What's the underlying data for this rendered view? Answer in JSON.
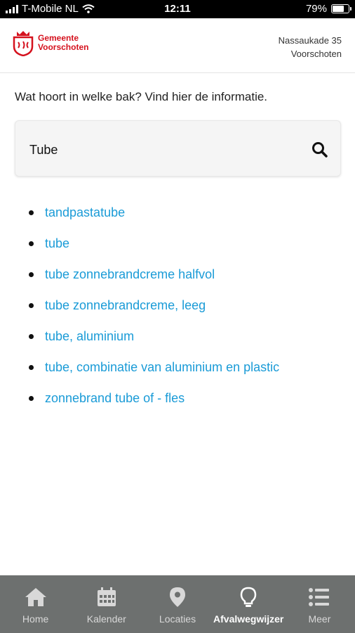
{
  "status_bar": {
    "carrier": "T-Mobile NL",
    "time": "12:11",
    "battery": "79%",
    "battery_level": 0.79
  },
  "header": {
    "logo_line1": "Gemeente",
    "logo_line2": "Voorschoten",
    "address_line1": "Nassaukade 35",
    "address_line2": "Voorschoten"
  },
  "intro": "Wat hoort in welke bak? Vind hier de informatie.",
  "search": {
    "value": "Tube"
  },
  "results": [
    "tandpastatube",
    "tube",
    "tube zonnebrandcreme halfvol",
    "tube zonnebrandcreme, leeg",
    "tube, aluminium",
    "tube, combinatie van aluminium en plastic",
    "zonnebrand tube of - fles"
  ],
  "colors": {
    "link": "#1a9bd7",
    "brand": "#d5121e",
    "tabbar": "#6d706f"
  },
  "tabs": [
    {
      "label": "Home",
      "icon": "home-icon"
    },
    {
      "label": "Kalender",
      "icon": "calendar-icon"
    },
    {
      "label": "Locaties",
      "icon": "map-pin-icon"
    },
    {
      "label": "Afvalwegwijzer",
      "icon": "lightbulb-icon",
      "active": true
    },
    {
      "label": "Meer",
      "icon": "menu-list-icon"
    }
  ]
}
